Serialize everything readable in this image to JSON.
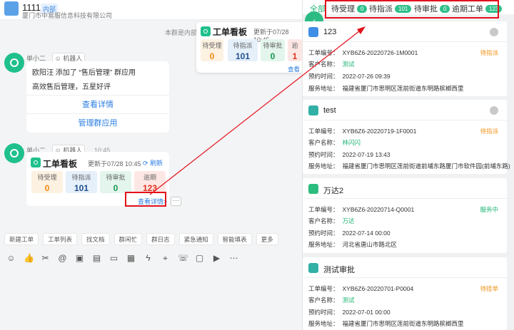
{
  "chat": {
    "title": "1111",
    "tag": "内部",
    "subtitle": "厦门市中易服信息科技有限公司",
    "notice": "本群是内部群",
    "messages": [
      {
        "sender": "单小二",
        "robot_tag": "机器人",
        "line1": "欧阳汪 添加了 “售后管理” 群应用",
        "line2": "高效售后管理，五星好评",
        "btn1": "查看详情",
        "btn2": "管理群应用"
      },
      {
        "sender": "单小二",
        "robot_tag": "机器人",
        "time": "10:45",
        "card_title": "工单看板",
        "updated": "更新于07/28 10:45",
        "refresh": "刷新",
        "stats": [
          {
            "label": "待受理",
            "value": "0"
          },
          {
            "label": "待指派",
            "value": "101"
          },
          {
            "label": "待审批",
            "value": "0"
          },
          {
            "label": "逾期",
            "value": "123"
          }
        ],
        "view_more": "查看详情>",
        "more": "···"
      }
    ],
    "mini_panel": {
      "title": "工单看板",
      "updated": "更新于07/28 10:45",
      "stats": [
        {
          "label": "待受理",
          "value": "0"
        },
        {
          "label": "待指派",
          "value": "101"
        },
        {
          "label": "待审批",
          "value": "0"
        },
        {
          "label": "逾",
          "value": "1"
        }
      ],
      "view_more": "查看"
    },
    "quick_actions": [
      "新建工单",
      "工单列表",
      "找文档",
      "群闲忙",
      "群日志",
      "紧急通知",
      "智能填表",
      "更多"
    ],
    "tool_icons": [
      "emoji-icon",
      "thumb-up-icon",
      "scissors-icon",
      "at-icon",
      "image-icon",
      "file-icon",
      "folder-icon",
      "doc-icon",
      "flash-icon",
      "pin-icon",
      "phone-icon",
      "live-icon",
      "video-icon",
      "more-icon"
    ]
  },
  "right_panel": {
    "tab_all": "全部",
    "tabs": [
      {
        "label": "待受理",
        "count": "0"
      },
      {
        "label": "待指派",
        "count": "101"
      },
      {
        "label": "待审批",
        "count": "0"
      },
      {
        "label": "逾期工单",
        "count": "123"
      }
    ],
    "field_labels": {
      "number": "工单编号：",
      "customer": "客户名称：",
      "appointment": "预约时间：",
      "address": "服务地址："
    },
    "orders": [
      {
        "name": "123",
        "number": "XYB6Z6-20220726-1M0001",
        "status": "待指派",
        "customer": "测试",
        "appointment": "2022-07-26 09:39",
        "address": "福建省厦门市思明区莲前街道东明路槟榔西里"
      },
      {
        "name": "test",
        "number": "XYB6Z6-20220719-1F0001",
        "status": "待指派",
        "customer": "林闪闪",
        "appointment": "2022-07-19 13:43",
        "address": "福建省厦门市思明区莲前街道前埔东路厦门市软件园(前埔东路)"
      },
      {
        "name": "万达2",
        "number": "XYB6Z6-20220714-Q0001",
        "status": "服务中",
        "customer": "万达",
        "appointment": "2022-07-14 00:00",
        "address": "河北省唐山市路北区"
      },
      {
        "name": "测试审批",
        "number": "XYB6Z6-20220701-P0004",
        "status": "待接单",
        "customer": "测试",
        "appointment": "2022-07-01 00:00",
        "address": "福建省厦门市思明区莲前街道东明路槟榔西里"
      }
    ]
  },
  "colors": {
    "accent_green": "#20b574",
    "link_blue": "#2a7de1",
    "highlight_red": "#e3101b",
    "pending_orange": "#f0961e"
  }
}
